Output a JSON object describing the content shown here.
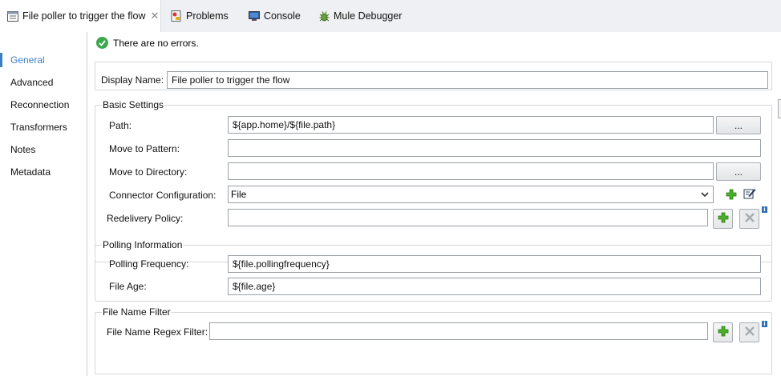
{
  "tabs": [
    {
      "label": "File poller to trigger the flow",
      "icon": "properties-icon",
      "active": true
    },
    {
      "label": "Problems",
      "icon": "problems-icon"
    },
    {
      "label": "Console",
      "icon": "console-icon"
    },
    {
      "label": "Mule Debugger",
      "icon": "debugger-bug-icon"
    }
  ],
  "sidebar": {
    "items": [
      {
        "label": "General",
        "active": true
      },
      {
        "label": "Advanced"
      },
      {
        "label": "Reconnection"
      },
      {
        "label": "Transformers"
      },
      {
        "label": "Notes"
      },
      {
        "label": "Metadata"
      }
    ]
  },
  "status": {
    "text": "There are no errors."
  },
  "display": {
    "label": "Display Name:",
    "value": "File poller to trigger the flow"
  },
  "basic": {
    "legend": "Basic Settings",
    "path": {
      "label": "Path:",
      "value": "${app.home}/${file.path}",
      "browse": "..."
    },
    "move_pattern": {
      "label": "Move to Pattern:",
      "value": ""
    },
    "move_dir": {
      "label": "Move to Directory:",
      "value": "",
      "browse": "..."
    },
    "connector": {
      "label": "Connector Configuration:",
      "value": "File"
    },
    "redelivery": {
      "label": "Redelivery Policy:",
      "value": ""
    }
  },
  "polling": {
    "legend": "Polling Information",
    "frequency": {
      "label": "Polling Frequency:",
      "value": "${file.pollingfrequency}"
    },
    "age": {
      "label": "File Age:",
      "value": "${file.age}"
    }
  },
  "filter": {
    "legend": "File Name Filter",
    "regex": {
      "label": "File Name Regex Filter:",
      "value": ""
    }
  },
  "colors": {
    "accent": "#3a7fc2",
    "success": "#3da94e",
    "add": "#4caf2a",
    "info": "#2f6fb8"
  }
}
